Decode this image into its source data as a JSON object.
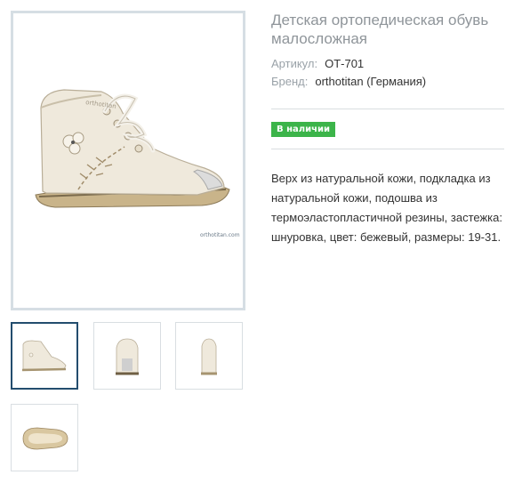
{
  "product": {
    "title": "Детская ортопедическая обувь малосложная",
    "sku_label": "Артикул:",
    "sku_value": "ОТ-701",
    "brand_label": "Бренд:",
    "brand_value": "orthotitan (Германия)",
    "stock_badge": "В наличии",
    "description": "Верх из натуральной кожи, подкладка из натуральной кожи, подошва из термоэластопластичной резины, застежка: шнуровка, цвет: бежевый, размеры: 19-31.",
    "image_watermark": "orthotitan.com"
  },
  "thumbnails": [
    {
      "name": "side-view",
      "active": true
    },
    {
      "name": "front-view",
      "active": false
    },
    {
      "name": "back-view",
      "active": false
    },
    {
      "name": "sole-view",
      "active": false
    }
  ],
  "colors": {
    "stock_badge": "#3cb44a",
    "title": "#8f959a",
    "main_image_border": "#d6dee4",
    "active_thumb_border": "#234d6e"
  }
}
